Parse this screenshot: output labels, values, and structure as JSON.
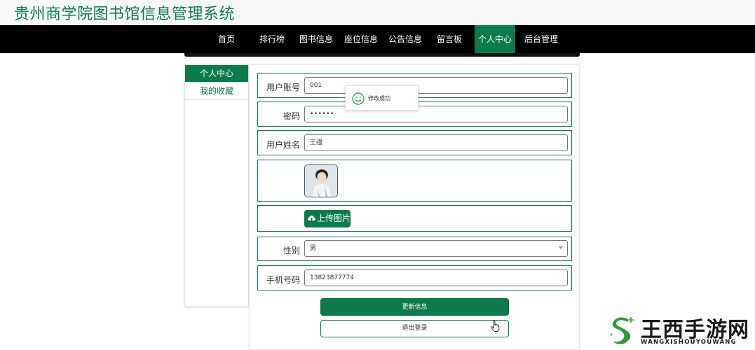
{
  "header": {
    "title": "贵州商学院图书馆信息管理系统"
  },
  "nav": {
    "items": [
      {
        "label": "首页"
      },
      {
        "label": "排行榜"
      },
      {
        "label": "图书信息"
      },
      {
        "label": "座位信息"
      },
      {
        "label": "公告信息"
      },
      {
        "label": "留言板"
      },
      {
        "label": "个人中心"
      },
      {
        "label": "后台管理"
      }
    ],
    "active_index": 6
  },
  "sidebar": {
    "items": [
      {
        "label": "个人中心"
      },
      {
        "label": "我的收藏"
      }
    ]
  },
  "form": {
    "account": {
      "label": "用户账号",
      "value": "001"
    },
    "password": {
      "label": "密码",
      "value": "••••••"
    },
    "name": {
      "label": "用户姓名",
      "value": "王强"
    },
    "upload_label": "上传图片",
    "gender": {
      "label": "性别",
      "value": "男"
    },
    "phone": {
      "label": "手机号码",
      "value": "13823877774"
    }
  },
  "buttons": {
    "update": "更新信息",
    "logout": "退出登录"
  },
  "toast": {
    "message": "修改成功"
  },
  "watermark": {
    "text": "王西手游网",
    "sub": "WANGXISHOUYOUWANG"
  },
  "colors": {
    "accent": "#0b7b4b",
    "navbar": "#000000"
  }
}
